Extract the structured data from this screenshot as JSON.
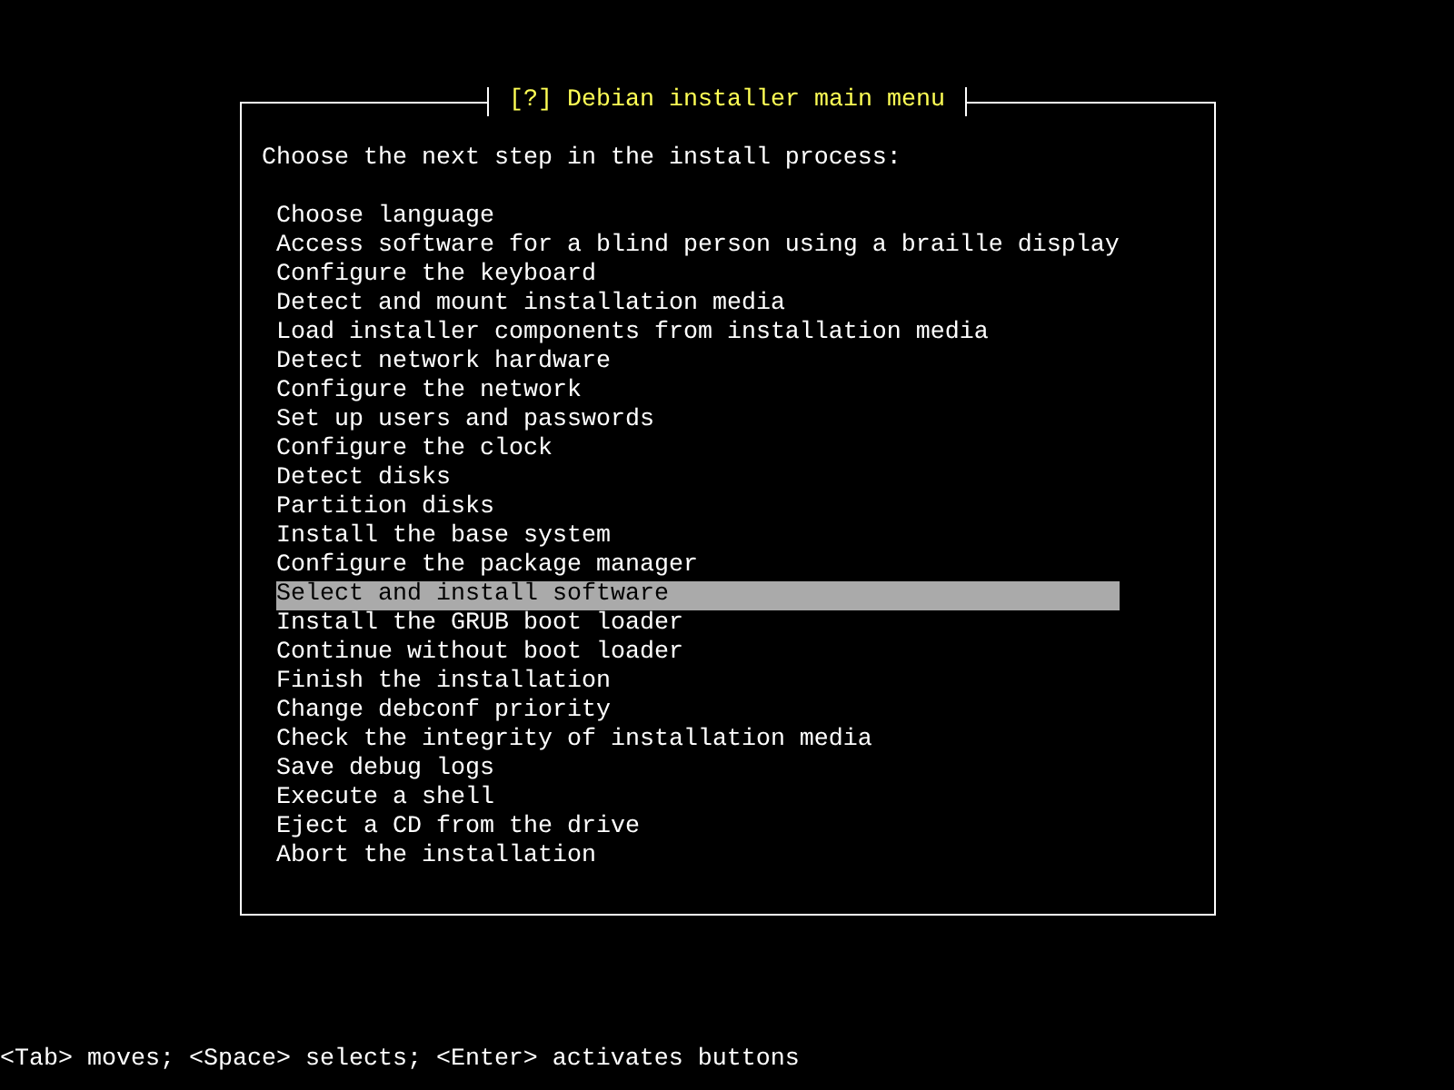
{
  "dialog": {
    "title": "[?] Debian installer main menu",
    "prompt": "Choose the next step in the install process:",
    "items": [
      {
        "label": "Choose language",
        "selected": false
      },
      {
        "label": "Access software for a blind person using a braille display",
        "selected": false
      },
      {
        "label": "Configure the keyboard",
        "selected": false
      },
      {
        "label": "Detect and mount installation media",
        "selected": false
      },
      {
        "label": "Load installer components from installation media",
        "selected": false
      },
      {
        "label": "Detect network hardware",
        "selected": false
      },
      {
        "label": "Configure the network",
        "selected": false
      },
      {
        "label": "Set up users and passwords",
        "selected": false
      },
      {
        "label": "Configure the clock",
        "selected": false
      },
      {
        "label": "Detect disks",
        "selected": false
      },
      {
        "label": "Partition disks",
        "selected": false
      },
      {
        "label": "Install the base system",
        "selected": false
      },
      {
        "label": "Configure the package manager",
        "selected": false
      },
      {
        "label": "Select and install software",
        "selected": true
      },
      {
        "label": "Install the GRUB boot loader",
        "selected": false
      },
      {
        "label": "Continue without boot loader",
        "selected": false
      },
      {
        "label": "Finish the installation",
        "selected": false
      },
      {
        "label": "Change debconf priority",
        "selected": false
      },
      {
        "label": "Check the integrity of installation media",
        "selected": false
      },
      {
        "label": "Save debug logs",
        "selected": false
      },
      {
        "label": "Execute a shell",
        "selected": false
      },
      {
        "label": "Eject a CD from the drive",
        "selected": false
      },
      {
        "label": "Abort the installation",
        "selected": false
      }
    ]
  },
  "footer": {
    "hint": "<Tab> moves; <Space> selects; <Enter> activates buttons"
  }
}
